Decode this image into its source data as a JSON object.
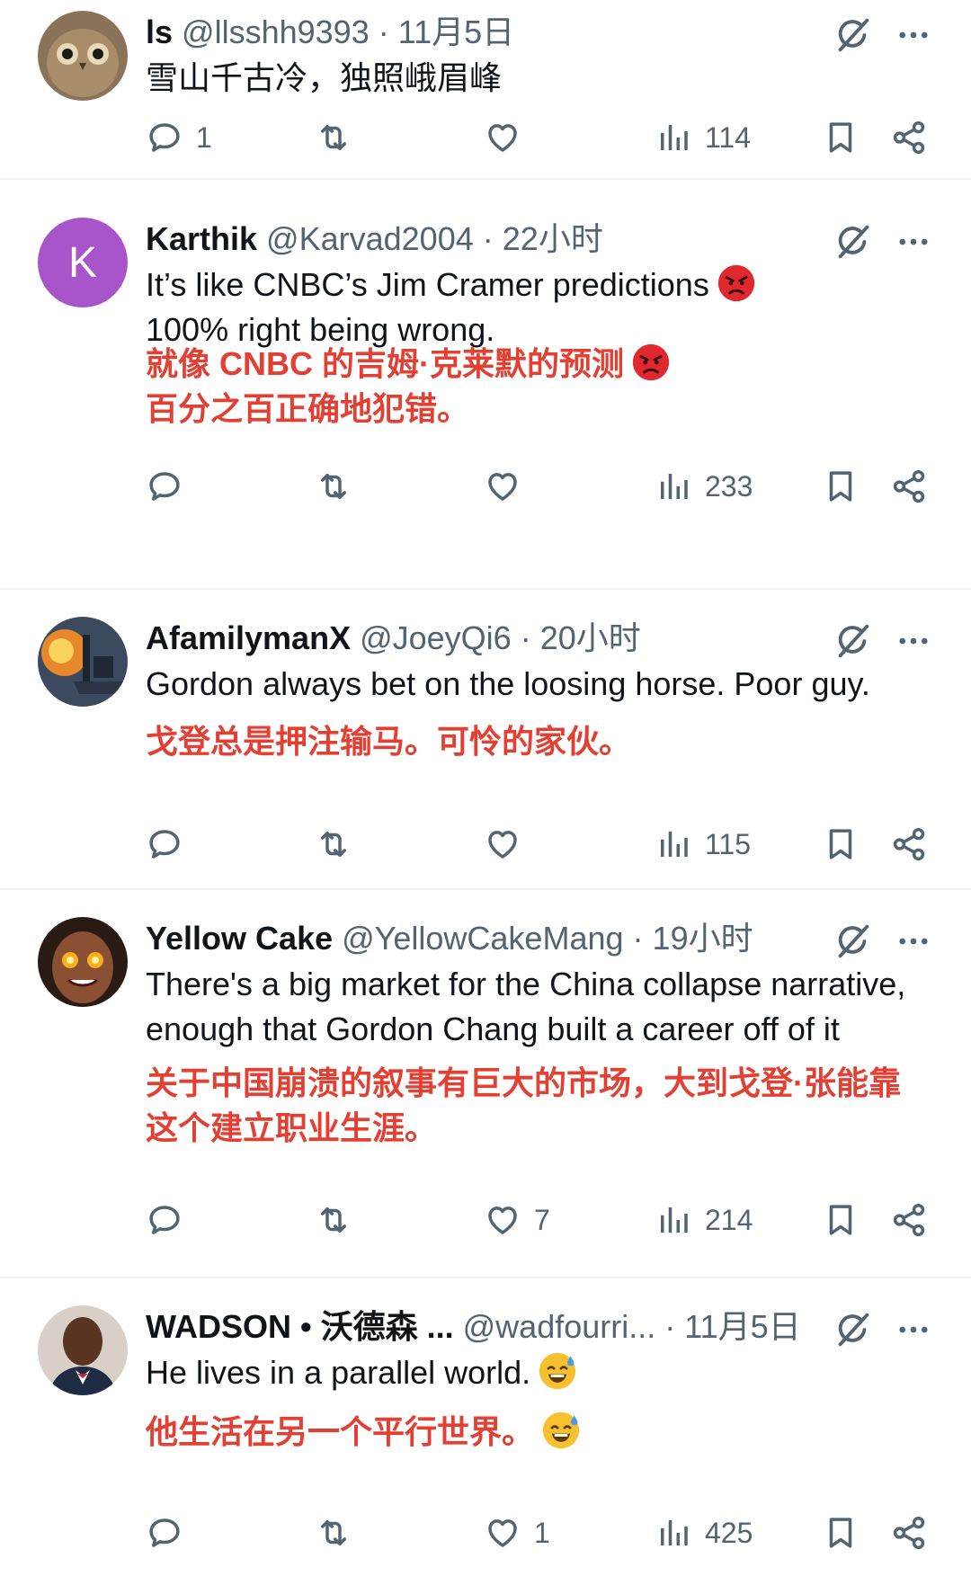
{
  "colors": {
    "text": "#0f1419",
    "secondary": "#536471",
    "translation": "#e33f32",
    "divider": "#eff3f4",
    "avatar_k": "#a855c9"
  },
  "icons": [
    "reply-icon",
    "retweet-icon",
    "like-icon",
    "views-icon",
    "bookmark-icon",
    "share-icon",
    "grok-icon",
    "more-icon"
  ],
  "tweets": [
    {
      "name": "ls",
      "handle": "@llsshh9393",
      "dot": "·",
      "time": "11月5日",
      "text": "雪山千古冷，独照峨眉峰",
      "translation": "",
      "replies": "1",
      "retweets": "",
      "likes": "",
      "views": "114"
    },
    {
      "name": "Karthik",
      "handle": "@Karvad2004",
      "dot": "·",
      "time": "22小时",
      "avatar_letter": "K",
      "text_line1": "It’s like CNBC’s Jim Cramer predictions",
      "text_line2": "100% right being wrong.",
      "trans_line1": "就像 CNBC 的吉姆·克莱默的预测",
      "trans_line2": "百分之百正确地犯错。",
      "replies": "",
      "retweets": "",
      "likes": "",
      "views": "233"
    },
    {
      "name": "AfamilymanX",
      "handle": "@JoeyQi6",
      "dot": "·",
      "time": "20小时",
      "text": "Gordon always bet on the loosing horse. Poor guy.",
      "translation": "戈登总是押注输马。可怜的家伙。",
      "replies": "",
      "retweets": "",
      "likes": "",
      "views": "115"
    },
    {
      "name": "Yellow Cake",
      "handle": "@YellowCakeMang",
      "dot": "·",
      "time": "19小时",
      "text": "There's a big market for the China collapse narrative, enough that Gordon Chang built a career off of it",
      "translation": "关于中国崩溃的叙事有巨大的市场，大到戈登·张能靠这个建立职业生涯。",
      "replies": "",
      "retweets": "",
      "likes": "7",
      "views": "214"
    },
    {
      "name": "WADSON • 沃德森 ...",
      "handle": "@wadfourri...",
      "dot": "·",
      "time": "11月5日",
      "text": "He lives in a parallel world.",
      "translation": "他生活在另一个平行世界。",
      "replies": "",
      "retweets": "",
      "likes": "1",
      "views": "425"
    }
  ]
}
